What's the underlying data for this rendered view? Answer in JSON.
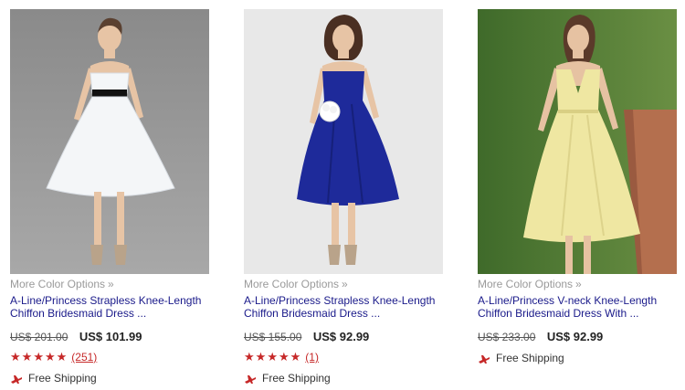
{
  "products": [
    {
      "more_options": "More Color Options",
      "title_line1": "A-Line/Princess Strapless Knee-Length",
      "title_line2": "Chiffon Bridesmaid Dress ...",
      "old_price": "US$ 201.00",
      "new_price": "US$ 101.99",
      "rating_stars": 5,
      "review_count": "(251)",
      "shipping": "Free Shipping",
      "dress_color": "#f4f6f8",
      "sash_color": "#111111",
      "bg_color": "#9a9a9a"
    },
    {
      "more_options": "More Color Options",
      "title_line1": "A-Line/Princess Strapless Knee-Length",
      "title_line2": "Chiffon Bridesmaid Dress ...",
      "old_price": "US$ 155.00",
      "new_price": "US$ 92.99",
      "rating_stars": 5,
      "review_count": "(1)",
      "shipping": "Free Shipping",
      "dress_color": "#1e2a9a",
      "sash_color": "#1e2a9a",
      "bg_color": "#e8e8e8"
    },
    {
      "more_options": "More Color Options",
      "title_line1": "A-Line/Princess V-neck Knee-Length",
      "title_line2": "Chiffon Bridesmaid Dress With ...",
      "old_price": "US$ 233.00",
      "new_price": "US$ 92.99",
      "shipping": "Free Shipping",
      "dress_color": "#efe7a2",
      "sash_color": "#efe7a2",
      "bg_color": "#4f7a33"
    }
  ],
  "icons": {
    "star": "star-icon",
    "plane": "airplane-icon",
    "chevron": "double-chevron-right-icon"
  },
  "colors": {
    "accent_red": "#c62828",
    "link_blue": "#1a1a8a",
    "muted_gray": "#9a9a9a"
  }
}
